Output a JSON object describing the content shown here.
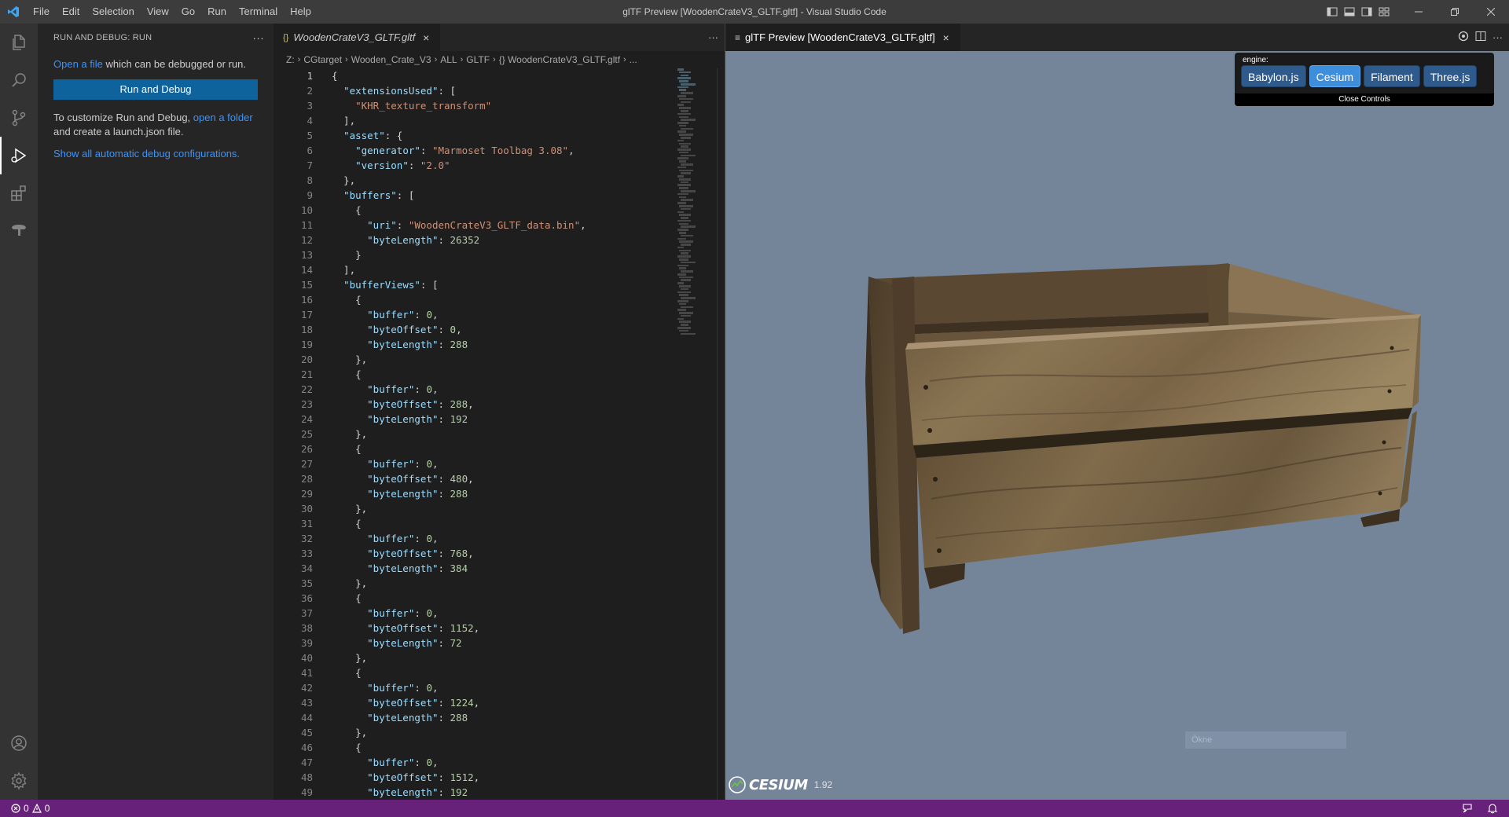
{
  "window": {
    "title": "glTF Preview [WoodenCrateV3_GLTF.gltf] - Visual Studio Code",
    "menu": [
      "File",
      "Edit",
      "Selection",
      "View",
      "Go",
      "Run",
      "Terminal",
      "Help"
    ]
  },
  "activity_bar": {
    "icons": [
      "files-icon",
      "search-icon",
      "source-control-icon",
      "run-debug-icon",
      "extensions-icon",
      "gltf-icon"
    ],
    "bottom_icons": [
      "account-icon",
      "settings-gear-icon"
    ]
  },
  "sidebar": {
    "header": "RUN AND DEBUG: RUN",
    "open_file_link": "Open a file",
    "open_file_rest": " which can be debugged or run.",
    "run_button": "Run and Debug",
    "customize_text": "To customize Run and Debug, ",
    "open_folder_link": "open a folder",
    "customize_rest": "and create a launch.json file.",
    "show_all_link": "Show all automatic debug configurations."
  },
  "editor": {
    "tab_label": "WoodenCrateV3_GLTF.gltf",
    "tab_icon": "{}",
    "breadcrumb": [
      "Z:",
      "CGtarget",
      "Wooden_Crate_V3",
      "ALL",
      "GLTF",
      "{} WoodenCrateV3_GLTF.gltf",
      "..."
    ],
    "current_line": 1,
    "lines": [
      [
        [
          "p",
          "{"
        ]
      ],
      [
        [
          "p",
          "  "
        ],
        [
          "k",
          "\"extensionsUsed\""
        ],
        [
          "p",
          ": ["
        ]
      ],
      [
        [
          "p",
          "    "
        ],
        [
          "s",
          "\"KHR_texture_transform\""
        ]
      ],
      [
        [
          "p",
          "  ],"
        ]
      ],
      [
        [
          "p",
          "  "
        ],
        [
          "k",
          "\"asset\""
        ],
        [
          "p",
          ": {"
        ]
      ],
      [
        [
          "p",
          "    "
        ],
        [
          "k",
          "\"generator\""
        ],
        [
          "p",
          ": "
        ],
        [
          "s",
          "\"Marmoset Toolbag 3.08\""
        ],
        [
          "p",
          ","
        ]
      ],
      [
        [
          "p",
          "    "
        ],
        [
          "k",
          "\"version\""
        ],
        [
          "p",
          ": "
        ],
        [
          "s",
          "\"2.0\""
        ]
      ],
      [
        [
          "p",
          "  },"
        ]
      ],
      [
        [
          "p",
          "  "
        ],
        [
          "k",
          "\"buffers\""
        ],
        [
          "p",
          ": ["
        ]
      ],
      [
        [
          "p",
          "    {"
        ]
      ],
      [
        [
          "p",
          "      "
        ],
        [
          "k",
          "\"uri\""
        ],
        [
          "p",
          ": "
        ],
        [
          "s",
          "\"WoodenCrateV3_GLTF_data.bin\""
        ],
        [
          "p",
          ","
        ]
      ],
      [
        [
          "p",
          "      "
        ],
        [
          "k",
          "\"byteLength\""
        ],
        [
          "p",
          ": "
        ],
        [
          "n",
          "26352"
        ]
      ],
      [
        [
          "p",
          "    }"
        ]
      ],
      [
        [
          "p",
          "  ],"
        ]
      ],
      [
        [
          "p",
          "  "
        ],
        [
          "k",
          "\"bufferViews\""
        ],
        [
          "p",
          ": ["
        ]
      ],
      [
        [
          "p",
          "    {"
        ]
      ],
      [
        [
          "p",
          "      "
        ],
        [
          "k",
          "\"buffer\""
        ],
        [
          "p",
          ": "
        ],
        [
          "n",
          "0"
        ],
        [
          "p",
          ","
        ]
      ],
      [
        [
          "p",
          "      "
        ],
        [
          "k",
          "\"byteOffset\""
        ],
        [
          "p",
          ": "
        ],
        [
          "n",
          "0"
        ],
        [
          "p",
          ","
        ]
      ],
      [
        [
          "p",
          "      "
        ],
        [
          "k",
          "\"byteLength\""
        ],
        [
          "p",
          ": "
        ],
        [
          "n",
          "288"
        ]
      ],
      [
        [
          "p",
          "    },"
        ]
      ],
      [
        [
          "p",
          "    {"
        ]
      ],
      [
        [
          "p",
          "      "
        ],
        [
          "k",
          "\"buffer\""
        ],
        [
          "p",
          ": "
        ],
        [
          "n",
          "0"
        ],
        [
          "p",
          ","
        ]
      ],
      [
        [
          "p",
          "      "
        ],
        [
          "k",
          "\"byteOffset\""
        ],
        [
          "p",
          ": "
        ],
        [
          "n",
          "288"
        ],
        [
          "p",
          ","
        ]
      ],
      [
        [
          "p",
          "      "
        ],
        [
          "k",
          "\"byteLength\""
        ],
        [
          "p",
          ": "
        ],
        [
          "n",
          "192"
        ]
      ],
      [
        [
          "p",
          "    },"
        ]
      ],
      [
        [
          "p",
          "    {"
        ]
      ],
      [
        [
          "p",
          "      "
        ],
        [
          "k",
          "\"buffer\""
        ],
        [
          "p",
          ": "
        ],
        [
          "n",
          "0"
        ],
        [
          "p",
          ","
        ]
      ],
      [
        [
          "p",
          "      "
        ],
        [
          "k",
          "\"byteOffset\""
        ],
        [
          "p",
          ": "
        ],
        [
          "n",
          "480"
        ],
        [
          "p",
          ","
        ]
      ],
      [
        [
          "p",
          "      "
        ],
        [
          "k",
          "\"byteLength\""
        ],
        [
          "p",
          ": "
        ],
        [
          "n",
          "288"
        ]
      ],
      [
        [
          "p",
          "    },"
        ]
      ],
      [
        [
          "p",
          "    {"
        ]
      ],
      [
        [
          "p",
          "      "
        ],
        [
          "k",
          "\"buffer\""
        ],
        [
          "p",
          ": "
        ],
        [
          "n",
          "0"
        ],
        [
          "p",
          ","
        ]
      ],
      [
        [
          "p",
          "      "
        ],
        [
          "k",
          "\"byteOffset\""
        ],
        [
          "p",
          ": "
        ],
        [
          "n",
          "768"
        ],
        [
          "p",
          ","
        ]
      ],
      [
        [
          "p",
          "      "
        ],
        [
          "k",
          "\"byteLength\""
        ],
        [
          "p",
          ": "
        ],
        [
          "n",
          "384"
        ]
      ],
      [
        [
          "p",
          "    },"
        ]
      ],
      [
        [
          "p",
          "    {"
        ]
      ],
      [
        [
          "p",
          "      "
        ],
        [
          "k",
          "\"buffer\""
        ],
        [
          "p",
          ": "
        ],
        [
          "n",
          "0"
        ],
        [
          "p",
          ","
        ]
      ],
      [
        [
          "p",
          "      "
        ],
        [
          "k",
          "\"byteOffset\""
        ],
        [
          "p",
          ": "
        ],
        [
          "n",
          "1152"
        ],
        [
          "p",
          ","
        ]
      ],
      [
        [
          "p",
          "      "
        ],
        [
          "k",
          "\"byteLength\""
        ],
        [
          "p",
          ": "
        ],
        [
          "n",
          "72"
        ]
      ],
      [
        [
          "p",
          "    },"
        ]
      ],
      [
        [
          "p",
          "    {"
        ]
      ],
      [
        [
          "p",
          "      "
        ],
        [
          "k",
          "\"buffer\""
        ],
        [
          "p",
          ": "
        ],
        [
          "n",
          "0"
        ],
        [
          "p",
          ","
        ]
      ],
      [
        [
          "p",
          "      "
        ],
        [
          "k",
          "\"byteOffset\""
        ],
        [
          "p",
          ": "
        ],
        [
          "n",
          "1224"
        ],
        [
          "p",
          ","
        ]
      ],
      [
        [
          "p",
          "      "
        ],
        [
          "k",
          "\"byteLength\""
        ],
        [
          "p",
          ": "
        ],
        [
          "n",
          "288"
        ]
      ],
      [
        [
          "p",
          "    },"
        ]
      ],
      [
        [
          "p",
          "    {"
        ]
      ],
      [
        [
          "p",
          "      "
        ],
        [
          "k",
          "\"buffer\""
        ],
        [
          "p",
          ": "
        ],
        [
          "n",
          "0"
        ],
        [
          "p",
          ","
        ]
      ],
      [
        [
          "p",
          "      "
        ],
        [
          "k",
          "\"byteOffset\""
        ],
        [
          "p",
          ": "
        ],
        [
          "n",
          "1512"
        ],
        [
          "p",
          ","
        ]
      ],
      [
        [
          "p",
          "      "
        ],
        [
          "k",
          "\"byteLength\""
        ],
        [
          "p",
          ": "
        ],
        [
          "n",
          "192"
        ]
      ]
    ]
  },
  "preview": {
    "tab_label": "glTF Preview [WoodenCrateV3_GLTF.gltf]",
    "engine_label": "engine:",
    "engines": [
      "Babylon.js",
      "Cesium",
      "Filament",
      "Three.js"
    ],
    "active_engine": "Cesium",
    "close_controls": "Close Controls",
    "cesium_brand": "CESIUM",
    "cesium_version": "1.92",
    "faint_box_text": "Ökne",
    "background_color": "#748599"
  },
  "statusbar": {
    "errors": "0",
    "warnings": "0",
    "color": "#68217a"
  }
}
